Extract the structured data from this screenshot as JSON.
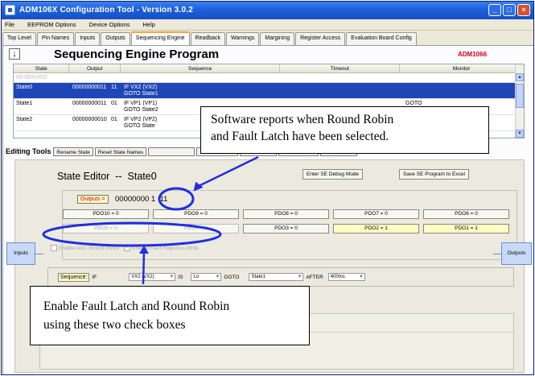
{
  "window": {
    "title": "ADM106X Configuration Tool - Version 3.0.2",
    "controls": [
      "_",
      "□",
      "×"
    ]
  },
  "menu": [
    "File",
    "EEPROM Options",
    "Device Options",
    "Help"
  ],
  "tabs": [
    "Top Level",
    "Pin Names",
    "Inputs",
    "Outputs",
    "Sequencing Engine",
    "Readback",
    "Warnings",
    "Margining",
    "Register Access",
    "Evaluation Board Config"
  ],
  "active_tab_index": 4,
  "page": {
    "title": "Sequencing Engine Program",
    "device": "ADM1066"
  },
  "grid": {
    "columns": [
      "State",
      "Output",
      "",
      "Sequence",
      "Timeout",
      "Monitor"
    ],
    "rows": [
      {
        "state": "RESERVED",
        "output": "",
        "bits": "",
        "sequence": [
          "",
          ""
        ],
        "timeout": "",
        "monitor": ""
      },
      {
        "state": "State0",
        "output": "00000000011",
        "bits": "11",
        "sequence": [
          "IF VX2 (VX2)",
          "GOTO State1"
        ],
        "timeout": "",
        "monitor": ""
      },
      {
        "state": "State1",
        "output": "00000000011",
        "bits": "01",
        "sequence": [
          "IF VP1 (VP1)",
          "GOTO State2"
        ],
        "timeout": "",
        "monitor": "GOTO"
      },
      {
        "state": "State2",
        "output": "00000000010",
        "bits": "01",
        "sequence": [
          "IF VP2 (VP2)",
          "GOTO State"
        ],
        "timeout": "",
        "monitor": ""
      }
    ]
  },
  "editing_tools": {
    "label": "Editing Tools",
    "buttons": [
      "Rename State",
      "Reset State Names"
    ]
  },
  "state_editor": {
    "title": "State Editor  --  State0",
    "debug_button": "Enter SE Debug Mode",
    "save_button": "Save SE Program to Excel",
    "outputs_label": "Outputs =",
    "outputs_value": "00000000",
    "outputs_value_highlight": "1  11",
    "pdo_row1": [
      "PDO10 = 0",
      "PDO9 = 0",
      "PDO8 = 0",
      "PDO7 = 0",
      "PDO6 = 0"
    ],
    "pdo_row2": [
      "PDO5 = 0",
      "PDO4 = 0",
      "PDO3 = 0",
      "PDO2 = 1",
      "PDO1 = 1"
    ],
    "pdo_row2_states": [
      "dim",
      "dim",
      "normal",
      "on",
      "on"
    ],
    "check_round_robin": "Enable ADC Round Robin",
    "check_fault_latch": "Enable Fault Registers Write",
    "sequence": {
      "label": "Sequence:",
      "if_word": "IF",
      "signal": "VX2 (VX2)",
      "is_word": "IS",
      "level": "Lo",
      "goto_word": "GOTO",
      "target": "State1",
      "after_word": "AFTER",
      "delay": "400ms"
    },
    "inputs_label": "Inputs",
    "outputs_side_label": "Outputs"
  },
  "annotations": {
    "top_callout": [
      "Software reports when Round Robin",
      "and Fault Latch have been selected."
    ],
    "bottom_callout": [
      "Enable Fault Latch and Round Robin",
      "using these two check boxes"
    ],
    "color": "#1e2fe0"
  }
}
